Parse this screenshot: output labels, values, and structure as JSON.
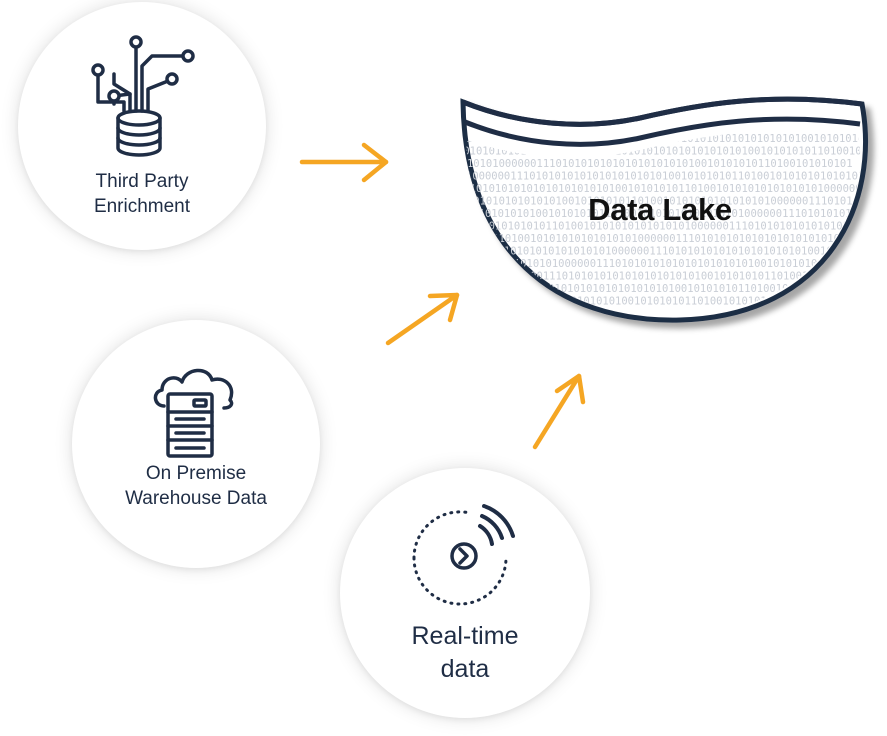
{
  "lake": {
    "title": "Data Lake",
    "binary_texture": "1010010101010101010101000000111010101010101010101010100101010101"
  },
  "sources": {
    "third_party": {
      "line1": "Third Party",
      "line2": "Enrichment",
      "icon": "database-circuit-icon"
    },
    "on_premise": {
      "line1": "On Premise",
      "line2": "Warehouse Data",
      "icon": "server-cloud-icon"
    },
    "real_time": {
      "line1": "Real-time",
      "line2": "data",
      "icon": "stream-signal-icon"
    }
  },
  "colors": {
    "arrow": "#f5a623",
    "ink": "#1f2d45",
    "binary": "#c9ced6"
  }
}
